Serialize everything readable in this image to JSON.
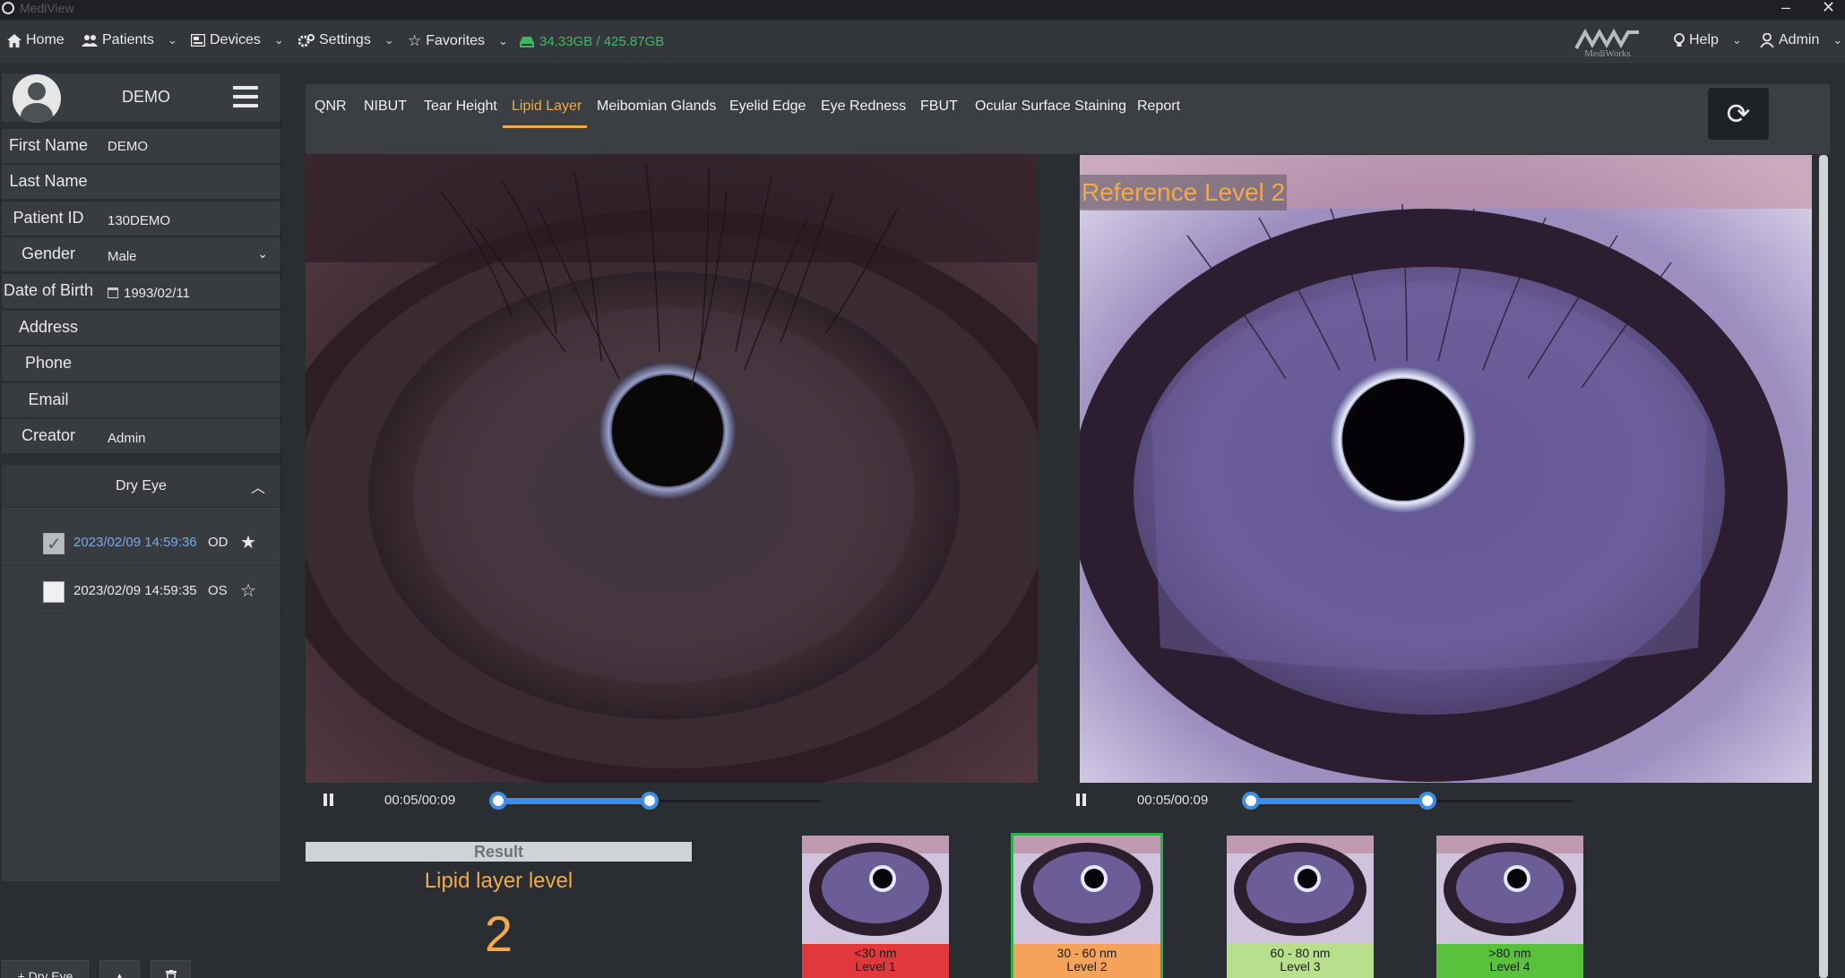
{
  "app": {
    "title": "MediView"
  },
  "nav": {
    "home": "Home",
    "patients": "Patients",
    "devices": "Devices",
    "settings": "Settings",
    "favorites": "Favorites",
    "storage": "34.33GB / 425.87GB",
    "brand": "MediWorks",
    "help": "Help",
    "user": "Admin"
  },
  "patient": {
    "name": "DEMO",
    "fields": [
      {
        "label": "First Name",
        "value": "DEMO"
      },
      {
        "label": "Last Name",
        "value": ""
      },
      {
        "label": "Patient ID",
        "value": "130DEMO"
      },
      {
        "label": "Gender",
        "value": "Male"
      },
      {
        "label": "Date of Birth",
        "value": "1993/02/11"
      },
      {
        "label": "Address",
        "value": ""
      },
      {
        "label": "Phone",
        "value": ""
      },
      {
        "label": "Email",
        "value": ""
      },
      {
        "label": "Creator",
        "value": "Admin"
      }
    ]
  },
  "visits": {
    "title": "Dry Eye",
    "items": [
      {
        "datetime": "2023/02/09 14:59:36",
        "eye": "OD",
        "checked": true,
        "favorite": true
      },
      {
        "datetime": "2023/02/09 14:59:35",
        "eye": "OS",
        "checked": false,
        "favorite": false
      }
    ],
    "add_label": "+ Dry Eye"
  },
  "tabs": [
    "QNR",
    "NIBUT",
    "Tear Height",
    "Lipid Layer",
    "Meibomian Glands",
    "Eyelid Edge",
    "Eye Redness",
    "FBUT",
    "Ocular Surface Staining",
    "Report"
  ],
  "active_tab": "Lipid Layer",
  "reference_label": "Reference Level 2",
  "players": [
    {
      "time": "00:05/00:09",
      "range_start": 0.0,
      "range_end": 0.47
    },
    {
      "time": "00:05/00:09",
      "range_start": 0.0,
      "range_end": 0.55
    }
  ],
  "result": {
    "header": "Result",
    "title": "Lipid layer level",
    "value": "2"
  },
  "levels": [
    {
      "range": "<30 nm",
      "level": "Level 1",
      "color": "#e0383b",
      "selected": false
    },
    {
      "range": "30 - 60 nm",
      "level": "Level 2",
      "color": "#f5a35a",
      "selected": true
    },
    {
      "range": "60 - 80 nm",
      "level": "Level 3",
      "color": "#b7e08d",
      "selected": false
    },
    {
      "range": ">80 nm",
      "level": "Level 4",
      "color": "#59c13c",
      "selected": false
    }
  ],
  "colors": {
    "accent": "#f2a94a",
    "storage": "#3fb863",
    "slider": "#3d8ee8"
  }
}
